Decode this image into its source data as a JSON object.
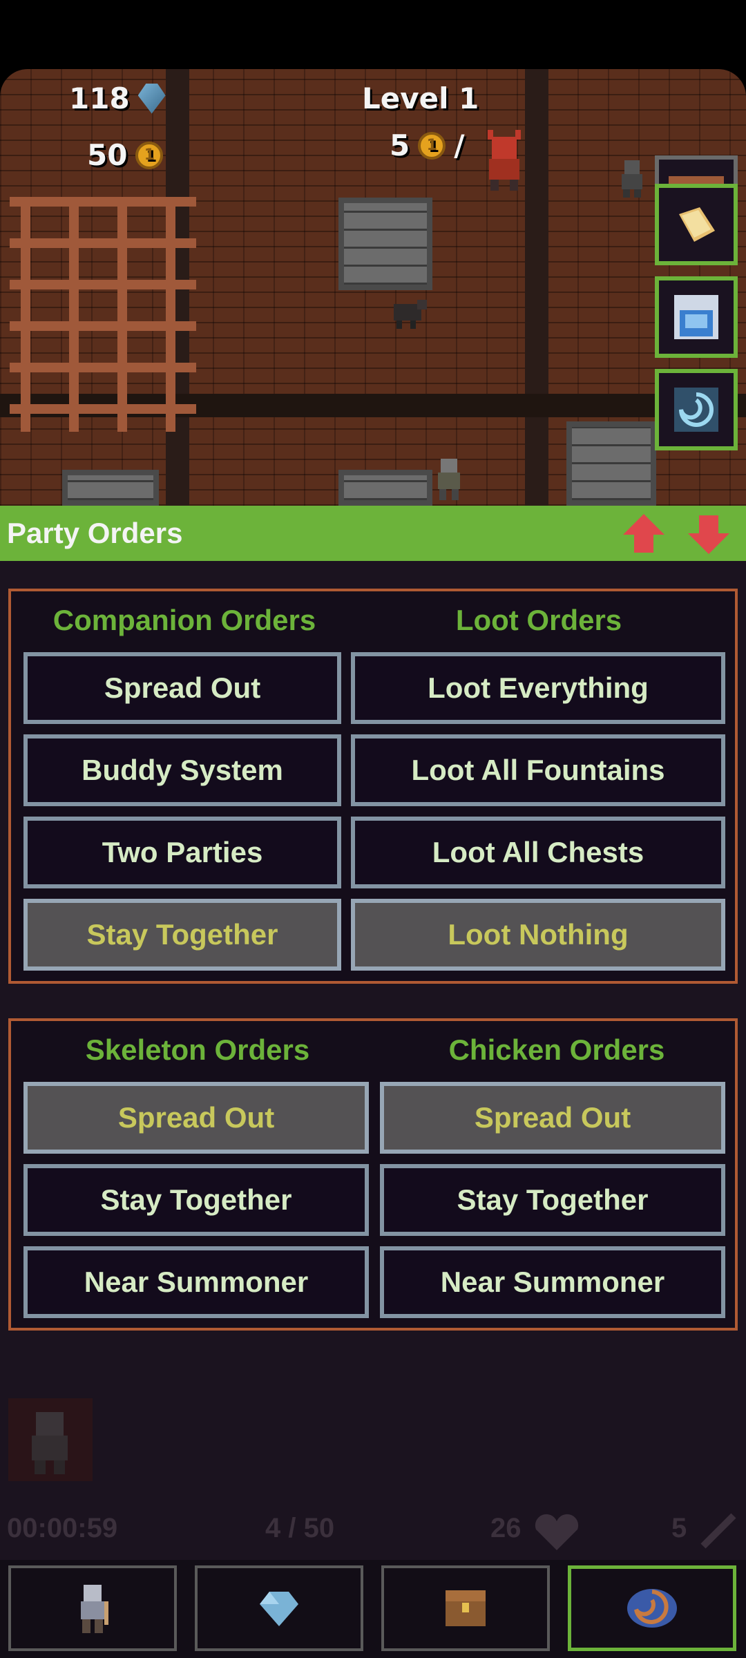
{
  "hud": {
    "gems": "118",
    "gold": "50",
    "level": "Level 1",
    "coin_glyph": "1",
    "kill_cost": "5",
    "kill_sep": "/"
  },
  "side_buttons": [
    "menu-icon",
    "scroll-icon",
    "potion-icon",
    "portal-icon"
  ],
  "party": {
    "title": "Party Orders"
  },
  "companion": {
    "title": "Companion Orders",
    "options": [
      "Spread Out",
      "Buddy System",
      "Two Parties",
      "Stay Together"
    ],
    "selected": "Stay Together"
  },
  "loot": {
    "title": "Loot Orders",
    "options": [
      "Loot Everything",
      "Loot All Fountains",
      "Loot All Chests",
      "Loot Nothing"
    ],
    "selected": "Loot Nothing"
  },
  "skeleton": {
    "title": "Skeleton Orders",
    "options": [
      "Spread Out",
      "Stay Together",
      "Near Summoner"
    ],
    "selected": "Spread Out"
  },
  "chicken": {
    "title": "Chicken Orders",
    "options": [
      "Spread Out",
      "Stay Together",
      "Near Summoner"
    ],
    "selected": "Spread Out"
  },
  "status": {
    "timer": "00:00:59",
    "party_count": "4 / 50",
    "health": "26",
    "attack": "5"
  },
  "bottom_nav": [
    "hero-icon",
    "gem-icon",
    "chest-icon",
    "portal-icon"
  ],
  "colors": {
    "accent_green": "#6cb33a",
    "panel_border": "#b05a33",
    "selected_text": "#c8c85c",
    "button_text": "#d6ebc4"
  }
}
